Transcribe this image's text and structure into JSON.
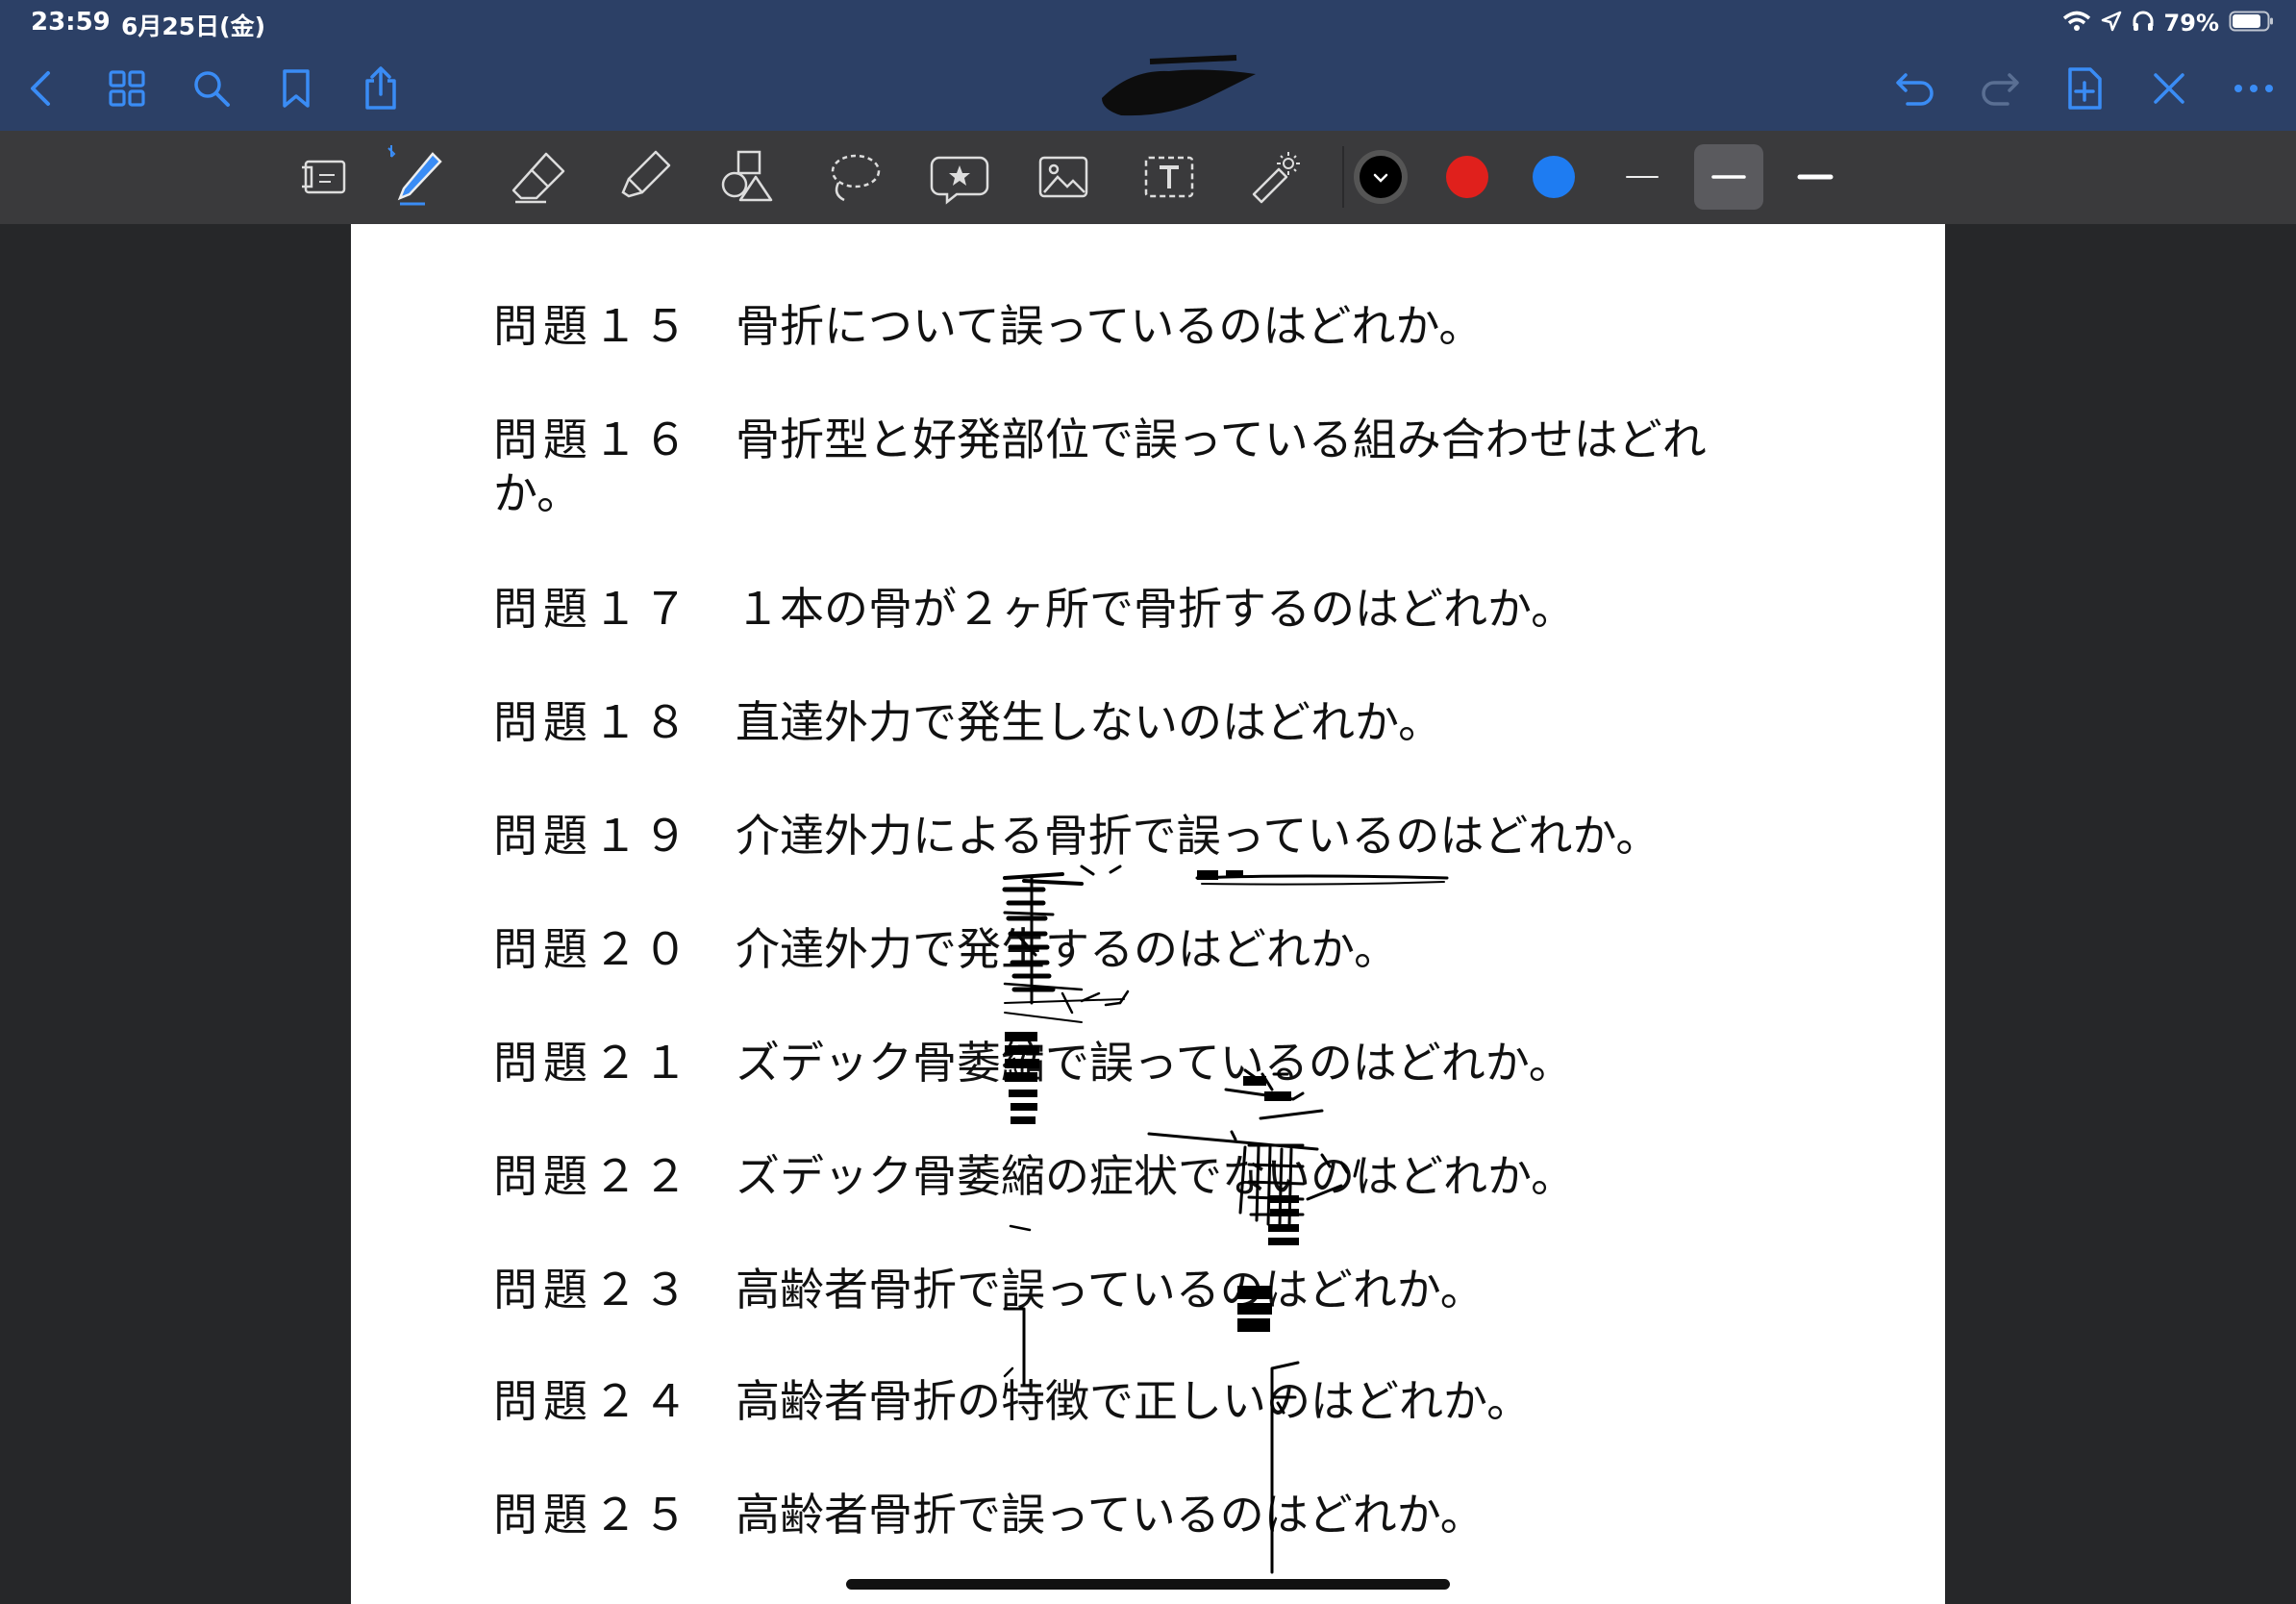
{
  "status": {
    "time": "23:59",
    "date": "6月25日(金)",
    "battery": "79%"
  },
  "nav": {
    "left_icons": [
      "back-icon",
      "grid-icon",
      "search-icon",
      "bookmark-icon",
      "share-icon"
    ],
    "right_icons": [
      "undo-icon",
      "redo-icon",
      "add-page-icon",
      "close-icon",
      "more-icon"
    ]
  },
  "toolbar": {
    "tools": [
      "page-layout-icon",
      "pen-icon",
      "eraser-icon",
      "highlighter-icon",
      "shapes-icon",
      "lasso-icon",
      "elements-icon",
      "image-icon",
      "text-tool-icon",
      "laser-pointer-icon"
    ],
    "colors": [
      "#000000",
      "#e0201c",
      "#1e7cf2"
    ],
    "selected_color": "#000000",
    "stroke_widths": [
      "thin",
      "medium",
      "thick"
    ],
    "selected_stroke": "medium"
  },
  "document": {
    "questions": [
      {
        "num": "問題１５",
        "text": "骨折について誤っているのはどれか。"
      },
      {
        "num": "問題１６",
        "text": "骨折型と好発部位で誤っている組み合わせはどれ",
        "cont": "か。"
      },
      {
        "num": "問題１７",
        "text": "１本の骨が２ヶ所で骨折するのはどれか。"
      },
      {
        "num": "問題１８",
        "text": "直達外力で発生しないのはどれか。"
      },
      {
        "num": "問題１９",
        "text": "介達外力による骨折で誤っているのはどれか。"
      },
      {
        "num": "問題２０",
        "text": "介達外力で発生するのはどれか。"
      },
      {
        "num": "問題２１",
        "text": "ズデック骨萎縮で誤っているのはどれか。"
      },
      {
        "num": "問題２２",
        "text": "ズデック骨萎縮の症状でないのはどれか。"
      },
      {
        "num": "問題２３",
        "text": "高齢者骨折で誤っているのはどれか。"
      },
      {
        "num": "問題２４",
        "text": "高齢者骨折の特徴で正しいのはどれか。"
      },
      {
        "num": "問題２５",
        "text": "高齢者骨折で誤っているのはどれか。"
      }
    ]
  }
}
